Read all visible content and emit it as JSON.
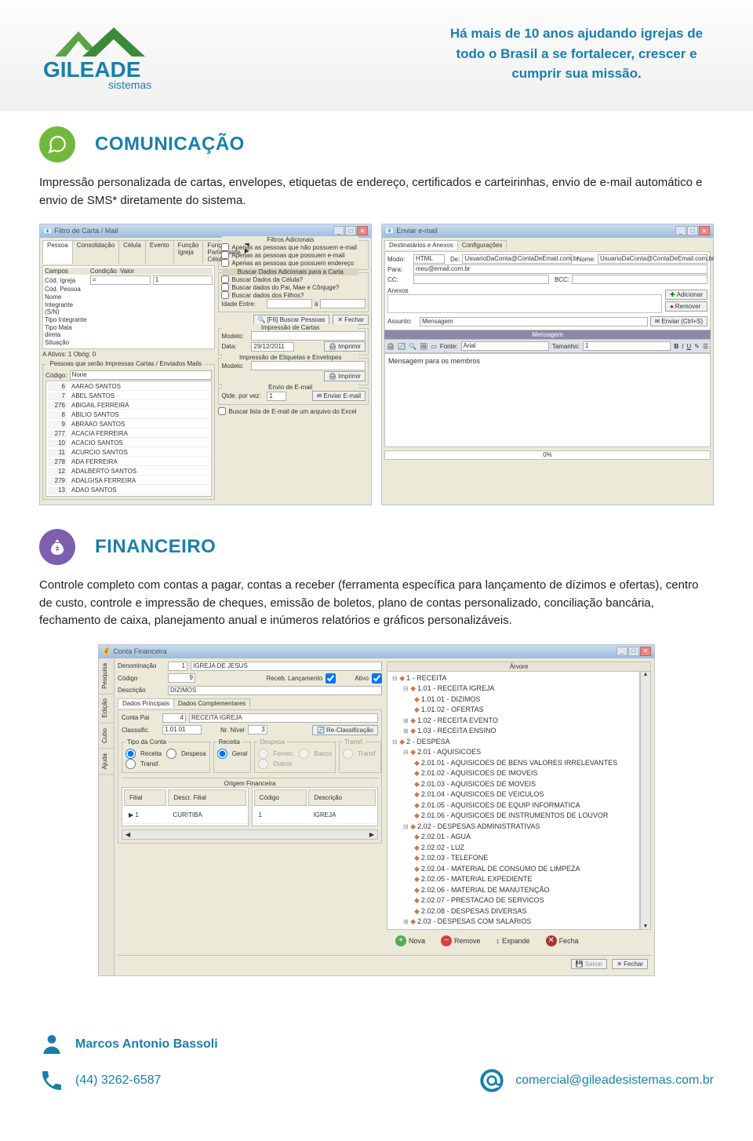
{
  "header": {
    "brand_main": "GILEADE",
    "brand_sub": "sistemas",
    "tagline": "Há mais de 10 anos ajudando igrejas de todo o Brasil a se fortalecer, crescer e cumprir sua missão."
  },
  "comunicacao": {
    "title": "COMUNICAÇÃO",
    "desc": "Impressão personalizada de cartas, envelopes, etiquetas de endereço, certificados e carteirinhas, envio de e-mail automático e envio de SMS* diretamente do sistema.",
    "win_filtro": {
      "title": "Filtro de Carta / Mail",
      "tabs": [
        "Pessoa",
        "Consolidação",
        "Célula",
        "Evento",
        "Função Igreja",
        "Função Participante Célula"
      ],
      "field_headers": [
        "Campos",
        "Condição",
        "Valor"
      ],
      "fields": [
        "Cód. Igreja",
        "Cód. Pessoa",
        "Nome",
        "Integrante (S/N)",
        "Tipo Integrante",
        "Tipo Mala direta",
        "Situação"
      ],
      "cond_value": "=",
      "val_value": "1",
      "ativos_label": "A  Ativos: 1   Obrig: 0",
      "list_title": "Pessoas que serão Impressas Cartas / Enviados Mails",
      "code_label": "Código:",
      "code_value": "None",
      "rows": [
        {
          "c": "6",
          "n": "AARAO SANTOS"
        },
        {
          "c": "7",
          "n": "ABEL SANTOS"
        },
        {
          "c": "276",
          "n": "ABIGAIL FERREIRA"
        },
        {
          "c": "8",
          "n": "ABILIO SANTOS"
        },
        {
          "c": "9",
          "n": "ABRAAO SANTOS"
        },
        {
          "c": "277",
          "n": "ACACIA FERREIRA"
        },
        {
          "c": "10",
          "n": "ACACIO SANTOS"
        },
        {
          "c": "11",
          "n": "ACURCIO SANTOS"
        },
        {
          "c": "278",
          "n": "ADA FERREIRA"
        },
        {
          "c": "12",
          "n": "ADALBERTO SANTOS"
        },
        {
          "c": "279",
          "n": "ADALGISA FERREIRA"
        },
        {
          "c": "13",
          "n": "ADAO SANTOS"
        }
      ],
      "grp_filtros": "Filtros Adicionais",
      "chk1": "Apenas as pessoas que não possuem e-mail",
      "chk2": "Apenas as pessoas que possuem e-mail",
      "chk3": "Apenas as pessoas que possuem endereço",
      "grp_buscar": "Buscar Dados Adicionais para a Carta",
      "chk4": "Buscar Dados da Célula?",
      "chk5": "Buscar dados do Pai, Mae e Cônjuge?",
      "chk6": "Buscar dados dos Filhos?",
      "idade_label": "Idade Entre:",
      "idade_a": "à",
      "btn_f6": "[F6] Buscar Pessoas",
      "btn_fechar": "Fechar",
      "grp_cartas": "Impressão de Cartas",
      "modelo_lbl": "Modelo:",
      "data_lbl": "Data:",
      "data_val": "29/12/2011",
      "btn_imprimir": "Imprimir",
      "grp_etiq": "Impressão de Etiquetas e Envelopes",
      "grp_email": "Envio de E-mail",
      "qtde_lbl": "Qtde. por vez:",
      "qtde_val": "1",
      "btn_enviar": "Enviar E-mail",
      "excel_chk": "Buscar lista de E-mail de um arquivo do Excel"
    },
    "win_email": {
      "title": "Enviar e-mail",
      "tabs": [
        "Destinatários e Anexos",
        "Configurações"
      ],
      "modo_lbl": "Modo:",
      "modo_val": "HTML",
      "de_lbl": "De:",
      "de_val": "UsuarioDaConta@ContaDeEmail.com.br",
      "nome_lbl": "Nome:",
      "nome_val": "UsuarioDaConta@ContaDeEmail.com.br",
      "para_lbl": "Para:",
      "para_val": "meu@email.com.br",
      "cc_lbl": "CC:",
      "bcc_lbl": "BCC:",
      "anexos_lbl": "Anexos",
      "btn_add": "Adicionar",
      "btn_rem": "Remover",
      "assunto_lbl": "Assunto:",
      "assunto_val": "Mensagem",
      "btn_send": "Enviar (Ctrl+S)",
      "msg_title": "Mensagem",
      "fonte_lbl": "Fonte:",
      "fonte_val": "Arial",
      "tam_lbl": "Tamanho:",
      "tam_val": "1",
      "body": "Mensagem para os membros",
      "progress": "0%"
    }
  },
  "financeiro": {
    "title": "FINANCEIRO",
    "desc": "Controle completo com contas a pagar, contas a receber (ferramenta específica para lançamento de dízimos e ofertas), centro de custo, controle e impressão de cheques, emissão de boletos, plano de contas personalizado, conciliação bancária, fechamento de caixa, planejamento anual e inúmeros relatórios e gráficos personalizáveis.",
    "win": {
      "title": "Conta Financeira",
      "vtabs": [
        "Pesquisa",
        "Edição",
        "Cubo",
        "Ajuda"
      ],
      "denom_lbl": "Denominação",
      "denom_code": "1",
      "denom_val": "IGREJA DE JESUS",
      "codigo_lbl": "Código",
      "codigo_val": "9",
      "receb_lbl": "Receb. Lançamento",
      "ativo_lbl": "Ativo",
      "descr_lbl": "Descrição",
      "descr_val": "DIZIMOS",
      "tabs": [
        "Dados Principais",
        "Dados Complementares"
      ],
      "contapai_lbl": "Conta Pai",
      "contapai_code": "4",
      "contapai_val": "RECEITA IGREJA",
      "class_lbl": "Classsific.",
      "class_val": "1.01.01",
      "nivel_lbl": "Nr. Nível",
      "nivel_val": "3",
      "reclass_btn": "Re-Classificação",
      "tipo_grp": "Tipo da Conta",
      "tipo_opts": [
        "Receita",
        "Despesa",
        "Transf."
      ],
      "receita_grp": "Receita",
      "receita_opts": [
        "Geral"
      ],
      "despesa_grp": "Despesa",
      "despesa_opts": [
        "Fornec.",
        "Banco",
        "Outros"
      ],
      "transf_grp": "Transf.",
      "transf_opts": [
        "Transf."
      ],
      "origem_title": "Origem Financeira",
      "grid_cols1": [
        "Filial",
        "Descr. Filial"
      ],
      "grid_cols2": [
        "Código",
        "Descrição"
      ],
      "grid_row": [
        "1",
        "CURITIBA",
        "1",
        "IGREJA"
      ],
      "tree_title": "Árvore",
      "tree": [
        {
          "i": 0,
          "t": "1 - RECEITA",
          "pre": "⊟"
        },
        {
          "i": 1,
          "t": "1.01 - RECEITA IGREJA",
          "pre": "⊟"
        },
        {
          "i": 2,
          "t": "1.01.01 - DIZIMOS"
        },
        {
          "i": 2,
          "t": "1.01.02 - OFERTAS"
        },
        {
          "i": 1,
          "t": "1.02 - RECEITA EVENTO",
          "pre": "⊞"
        },
        {
          "i": 1,
          "t": "1.03 - RECEITA ENSINO",
          "pre": "⊞"
        },
        {
          "i": 0,
          "t": "2 - DESPESA",
          "pre": "⊟"
        },
        {
          "i": 1,
          "t": "2.01 - AQUISICOES",
          "pre": "⊟"
        },
        {
          "i": 2,
          "t": "2.01.01 - AQUISICOES DE BENS VALORES IRRELEVANTES"
        },
        {
          "i": 2,
          "t": "2.01.02 - AQUISICOES DE IMOVEIS"
        },
        {
          "i": 2,
          "t": "2.01.03 - AQUISICOES DE MOVEIS"
        },
        {
          "i": 2,
          "t": "2.01.04 - AQUISICOES DE VEICULOS"
        },
        {
          "i": 2,
          "t": "2.01.05 - AQUISICOES DE EQUIP INFORMATICA"
        },
        {
          "i": 2,
          "t": "2.01.06 - AQUISICOES DE INSTRUMENTOS DE LOUVOR"
        },
        {
          "i": 1,
          "t": "2.02 - DESPESAS ADMINISTRATIVAS",
          "pre": "⊟"
        },
        {
          "i": 2,
          "t": "2.02.01 - AGUA"
        },
        {
          "i": 2,
          "t": "2.02.02 - LUZ"
        },
        {
          "i": 2,
          "t": "2.02.03 - TELEFONE"
        },
        {
          "i": 2,
          "t": "2.02.04 - MATERIAL DE CONSUMO DE LIMPEZA"
        },
        {
          "i": 2,
          "t": "2.02.05 - MATERIAL EXPEDIENTE"
        },
        {
          "i": 2,
          "t": "2.02.06 - MATERIAL DE MANUTENÇÃO"
        },
        {
          "i": 2,
          "t": "2.02.07 - PRESTACAO DE SERVICOS"
        },
        {
          "i": 2,
          "t": "2.02.08 - DESPESAS DIVERSAS"
        },
        {
          "i": 1,
          "t": "2.03 - DESPESAS COM SALARIOS",
          "pre": "⊞"
        }
      ],
      "btn_nova": "Nova",
      "btn_remove": "Remove",
      "btn_expande": "Expande",
      "btn_fecha": "Fecha",
      "btn_salvar": "Salvar",
      "btn_fechar": "Fechar"
    }
  },
  "footer": {
    "name": "Marcos Antonio Bassoli",
    "phone": "(44) 3262-6587",
    "email": "comercial@gileadesistemas.com.br"
  }
}
